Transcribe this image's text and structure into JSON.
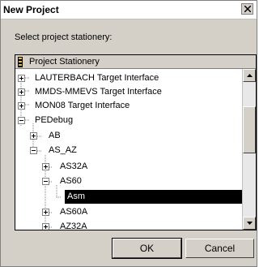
{
  "window": {
    "title": "New Project"
  },
  "dialog": {
    "prompt": "Select project stationery:"
  },
  "tree": {
    "header": "Project Stationery",
    "items": [
      {
        "label": "LAUTERBACH Target Interface",
        "toggle": "+"
      },
      {
        "label": "MMDS-MMEVS Target Interface",
        "toggle": "+"
      },
      {
        "label": "MON08 Target Interface",
        "toggle": "+"
      },
      {
        "label": "PEDebug",
        "toggle": "-"
      },
      {
        "label": "AB",
        "toggle": "+"
      },
      {
        "label": "AS_AZ",
        "toggle": "-"
      },
      {
        "label": "AS32A",
        "toggle": "+"
      },
      {
        "label": "AS60",
        "toggle": "-"
      },
      {
        "label": "Asm",
        "toggle": "",
        "selected": true
      },
      {
        "label": "AS60A",
        "toggle": "+"
      },
      {
        "label": "AZ32A",
        "toggle": "+"
      }
    ]
  },
  "buttons": {
    "ok": "OK",
    "cancel": "Cancel"
  },
  "icons": {
    "close": "close-icon",
    "scroll_up": "arrow-up-icon",
    "scroll_down": "arrow-down-icon"
  }
}
